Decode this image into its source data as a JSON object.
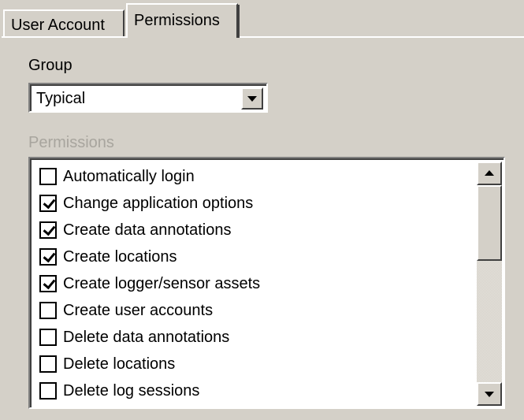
{
  "tabs": [
    {
      "label": "User Account",
      "active": false
    },
    {
      "label": "Permissions",
      "active": true
    }
  ],
  "group": {
    "label": "Group",
    "selected": "Typical"
  },
  "permissions": {
    "label": "Permissions",
    "items": [
      {
        "label": "Automatically login",
        "checked": false
      },
      {
        "label": "Change application options",
        "checked": true
      },
      {
        "label": "Create data annotations",
        "checked": true
      },
      {
        "label": "Create locations",
        "checked": true
      },
      {
        "label": "Create logger/sensor assets",
        "checked": true
      },
      {
        "label": "Create user accounts",
        "checked": false
      },
      {
        "label": "Delete data annotations",
        "checked": false
      },
      {
        "label": "Delete locations",
        "checked": false
      },
      {
        "label": "Delete log sessions",
        "checked": false
      }
    ]
  },
  "icons": {
    "dropdown": "chevron-down-icon",
    "scroll_up": "arrow-up-icon",
    "scroll_down": "arrow-down-icon",
    "check": "check-icon"
  },
  "colors": {
    "background": "#d4d0c8",
    "disabled_text": "#a8a59e"
  }
}
